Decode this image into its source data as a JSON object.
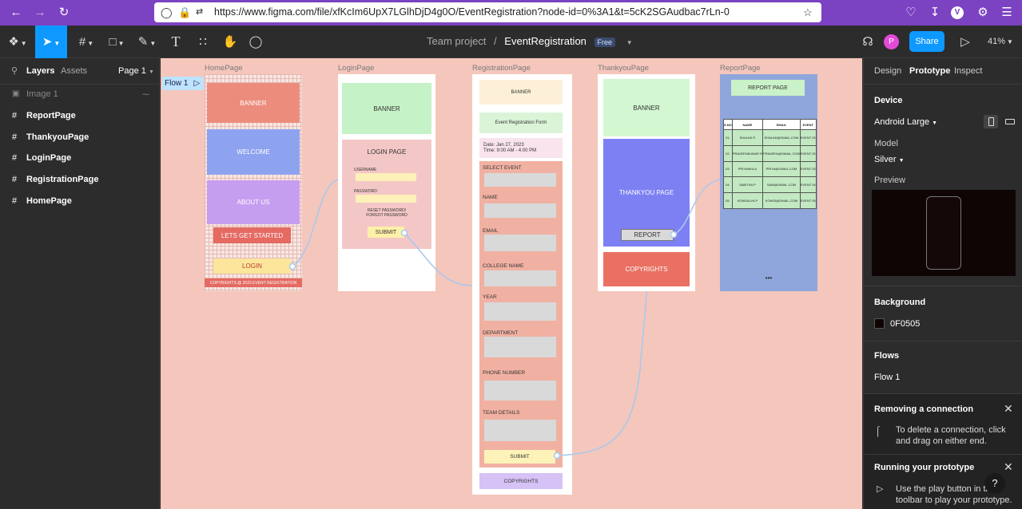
{
  "browser": {
    "url": "https://www.figma.com/file/xfKcIm6UpX7LGlhDjD4g0O/EventRegistration?node-id=0%3A1&t=5cK2SGAudbac7rLn-0",
    "profile_initial": "V"
  },
  "toolbar": {
    "breadcrumb_team": "Team project",
    "separator": "/",
    "file_name": "EventRegistration",
    "plan_badge": "Free",
    "avatar_initial": "P",
    "share_label": "Share",
    "zoom": "41%"
  },
  "left": {
    "tab_layers": "Layers",
    "tab_assets": "Assets",
    "page_selector": "Page 1",
    "layers": [
      "Image 1",
      "ReportPage",
      "ThankyouPage",
      "LoginPage",
      "RegistrationPage",
      "HomePage"
    ]
  },
  "right": {
    "tabs": [
      "Design",
      "Prototype",
      "Inspect"
    ],
    "device_heading": "Device",
    "device_value": "Android Large",
    "model_label": "Model",
    "model_value": "Silver",
    "preview_label": "Preview",
    "background_heading": "Background",
    "background_value": "0F0505",
    "background_color": "#0f0505",
    "flows_heading": "Flows",
    "flow_item": "Flow 1",
    "removing_title": "Removing a connection",
    "removing_text_1": "To delete a connection, click",
    "removing_text_2": "and drag on either end.",
    "running_title": "Running your prototype",
    "running_text_1": "Use the play button in the",
    "running_text_2": "toolbar to play your prototype.",
    "help": "?"
  },
  "canvas": {
    "flow_label": "Flow 1",
    "home": {
      "title": "HomePage",
      "banner": "BANNER",
      "welcome": "WELCOME",
      "about": "ABOUT US",
      "started": "LETS GET STARTED",
      "login": "LOGIN",
      "copyright": "COPYRIGHTS @ 2023 EVENT REGISTRATION"
    },
    "login": {
      "title": "LoginPage",
      "banner": "BANNER",
      "heading": "LOGIN PAGE",
      "username": "USERNAME",
      "password": "PASSWORD",
      "reset_1": "RESET PASSWORD/",
      "reset_2": "FORGOT PASSWORD",
      "submit": "SUBMIT"
    },
    "registration": {
      "title": "RegistrationPage",
      "banner": "BANNER",
      "form_title": "Event Registration Form",
      "date": "Date: Jan 27, 2023",
      "time": "Time: 9:00 AM - 4:00 PM",
      "fields": [
        "SELECT EVENT",
        "NAME",
        "EMAIL",
        "COLLEGE NAME",
        "YEAR",
        "DEPARTMENT",
        "PHONE NUMBER",
        "TEAM DETAILS"
      ],
      "submit": "SUBMIT",
      "copyrights": "COPYRIGHTS"
    },
    "thankyou": {
      "title": "ThankyouPage",
      "banner": "BANNER",
      "message": "THANKYOU PAGE",
      "report": "REPORT",
      "copyrights": "COPYRIGHTS"
    },
    "report": {
      "title": "ReportPage",
      "heading": "REPORT PAGE",
      "columns": [
        "S.NO",
        "NAME",
        "EMAIL",
        "EVENT"
      ],
      "rows": [
        [
          "01.",
          "SHALINI R",
          "SHALINI@GMAIL.COM",
          "EVENT 03"
        ],
        [
          "02.",
          "PRAVEENKUMAR R",
          "PRAVEEN@GMAIL.COM",
          "EVENT 02"
        ],
        [
          "03.",
          "PRIYANKA A",
          "PRIYA@GMAIL.COM",
          "EVENT 03"
        ],
        [
          "04.",
          "SABITHA P",
          "SABI@GMAIL.COM",
          "EVENT 04"
        ],
        [
          "05.",
          "KOWSALYA P",
          "KOWSI@GMAIL.COM",
          "EVENT 05"
        ]
      ],
      "more": "•••"
    }
  }
}
